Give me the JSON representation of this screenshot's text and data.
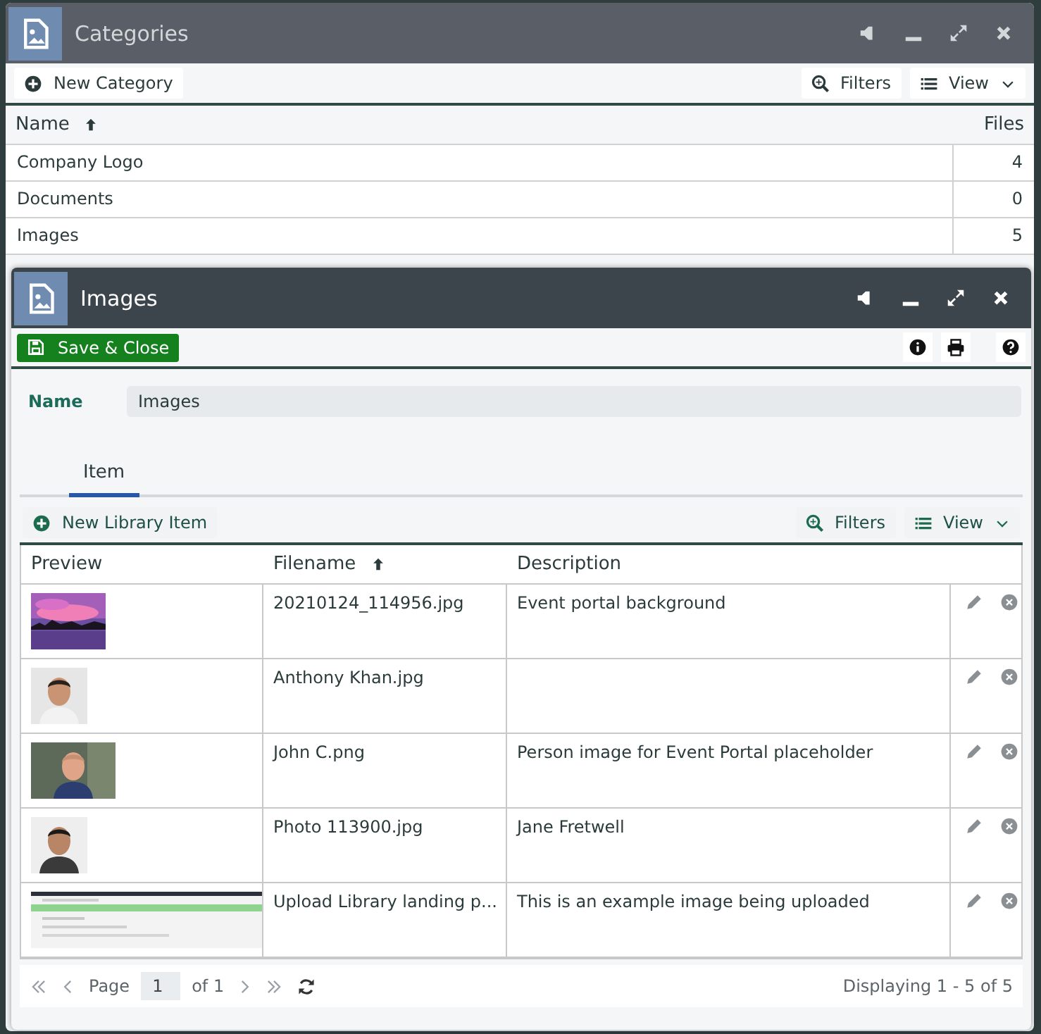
{
  "categories_window": {
    "title": "Categories",
    "toolbar": {
      "new_button": "New Category",
      "filters_button": "Filters",
      "view_button": "View"
    },
    "columns": [
      {
        "label": "Name",
        "sorted": true
      },
      {
        "label": "Files",
        "sorted": false
      }
    ],
    "rows": [
      {
        "name": "Company Logo",
        "files": "4"
      },
      {
        "name": "Documents",
        "files": "0"
      },
      {
        "name": "Images",
        "files": "5"
      }
    ]
  },
  "images_window": {
    "title": "Images",
    "toolbar": {
      "save_button": "Save & Close"
    },
    "form": {
      "name_label": "Name",
      "name_value": "Images"
    },
    "tabs": [
      {
        "label": "Item",
        "selected": true
      }
    ],
    "grid_toolbar": {
      "new_button": "New Library Item",
      "filters_button": "Filters",
      "view_button": "View"
    },
    "columns": [
      {
        "label": "Preview",
        "sorted": false
      },
      {
        "label": "Filename",
        "sorted": true
      },
      {
        "label": "Description",
        "sorted": false
      }
    ],
    "rows": [
      {
        "filename": "20210124_114956.jpg",
        "description": "Event portal background"
      },
      {
        "filename": "Anthony Khan.jpg"
      },
      {
        "filename": "John C.png",
        "description": "Person image for Event Portal placeholder"
      },
      {
        "filename": "Photo 113900.jpg",
        "description": "Jane Fretwell"
      },
      {
        "filename": "Upload Library landing p...",
        "description": "This is an example image being uploaded"
      }
    ],
    "pager": {
      "page_label": "Page",
      "page_value": "1",
      "of_label": "of 1",
      "summary": "Displaying 1 - 5 of 5"
    }
  }
}
